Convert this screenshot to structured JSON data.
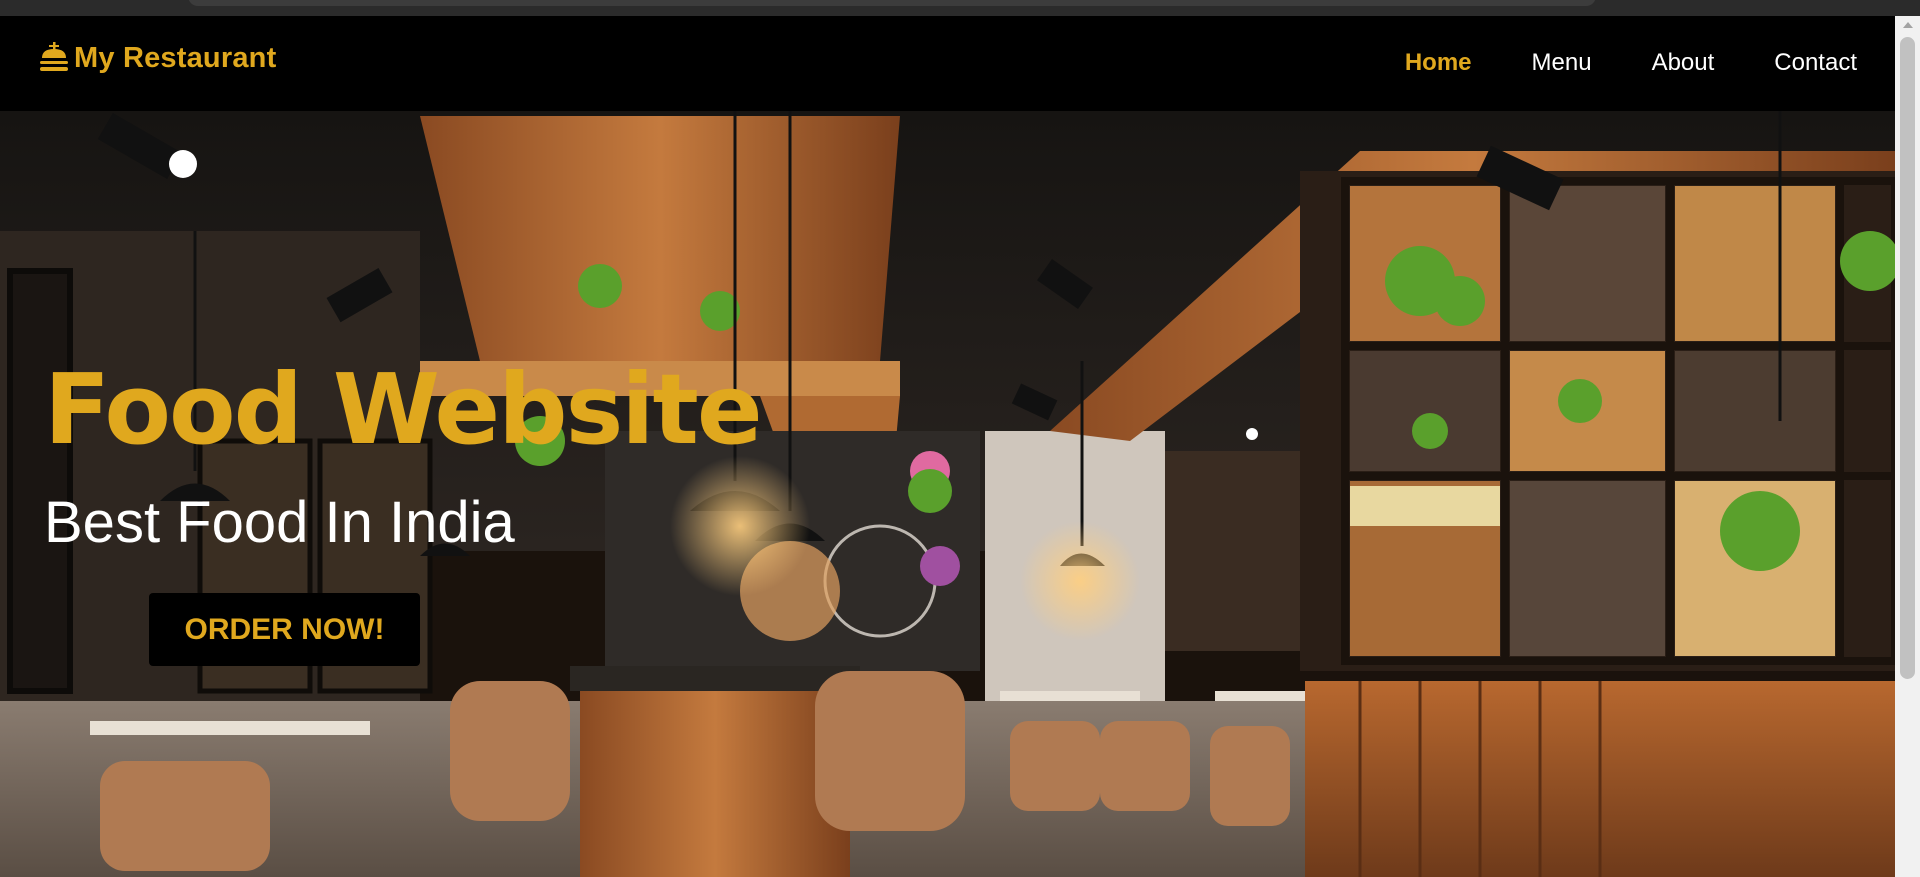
{
  "navbar": {
    "brand": "My Restaurant",
    "brand_icon": "burger-icon",
    "links": [
      {
        "label": "Home",
        "active": true
      },
      {
        "label": "Menu",
        "active": false
      },
      {
        "label": "About",
        "active": false
      },
      {
        "label": "Contact",
        "active": false
      }
    ]
  },
  "hero": {
    "title": "Food Website",
    "subtitle": "Best Food In India",
    "cta_label": "ORDER NOW!"
  },
  "colors": {
    "accent": "#e0a81e",
    "nav_bg": "#000000",
    "text": "#ffffff"
  }
}
